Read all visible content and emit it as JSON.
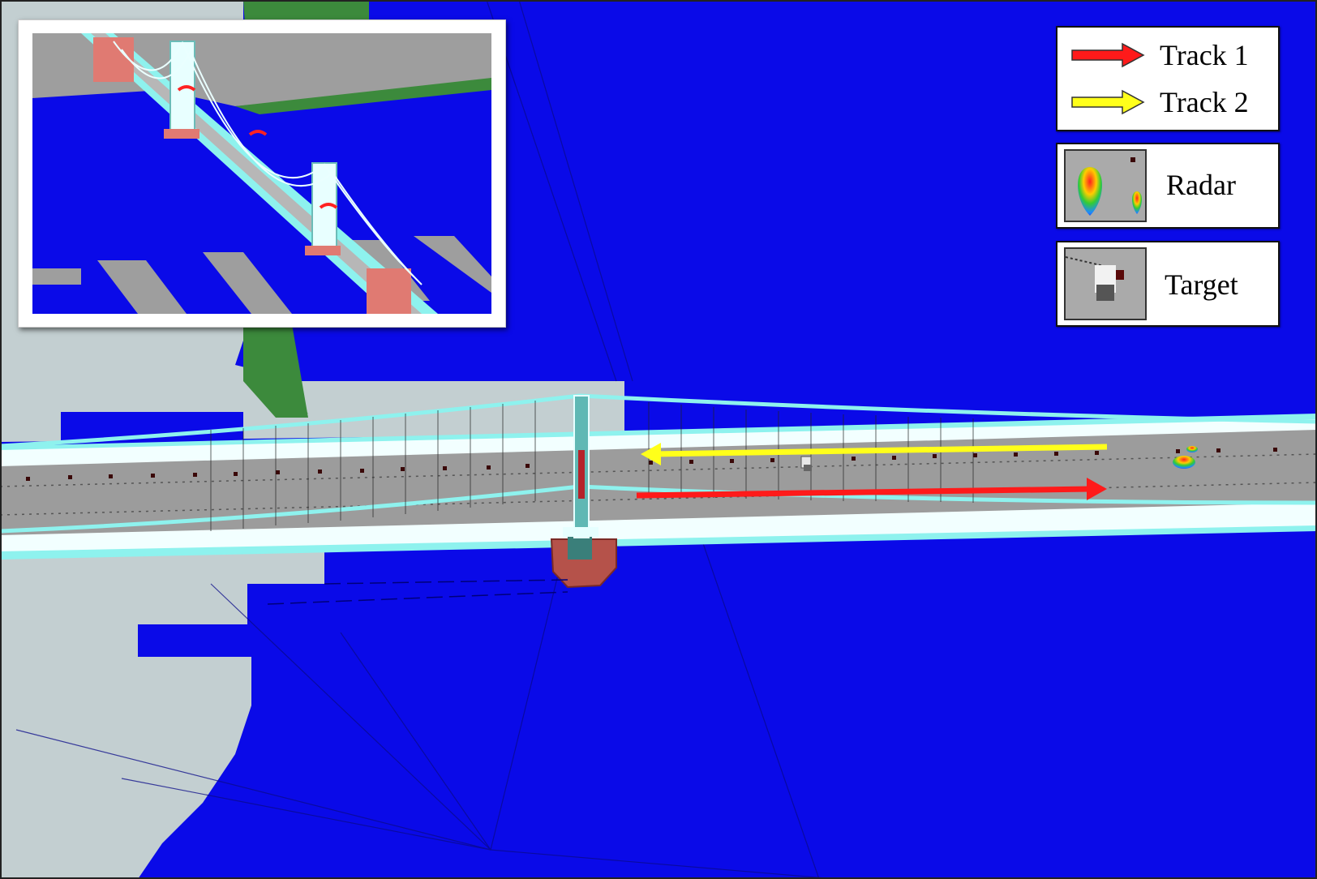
{
  "legend": {
    "track1_label": "Track 1",
    "track2_label": "Track 2",
    "radar_label": "Radar",
    "target_label": "Target"
  },
  "colors": {
    "water": "#0a0ae8",
    "land": "#c3cfd1",
    "grass": "#3c8a3c",
    "deck": "#9c9c9c",
    "cable": "#8ef2ee",
    "tower_base": "#b5524a",
    "track1": "#ff1a1a",
    "track2": "#ffff1a"
  },
  "icons": {
    "track1": "red-arrow-icon",
    "track2": "yellow-arrow-icon",
    "radar": "radar-lobe-icon",
    "target": "target-cube-icon"
  }
}
